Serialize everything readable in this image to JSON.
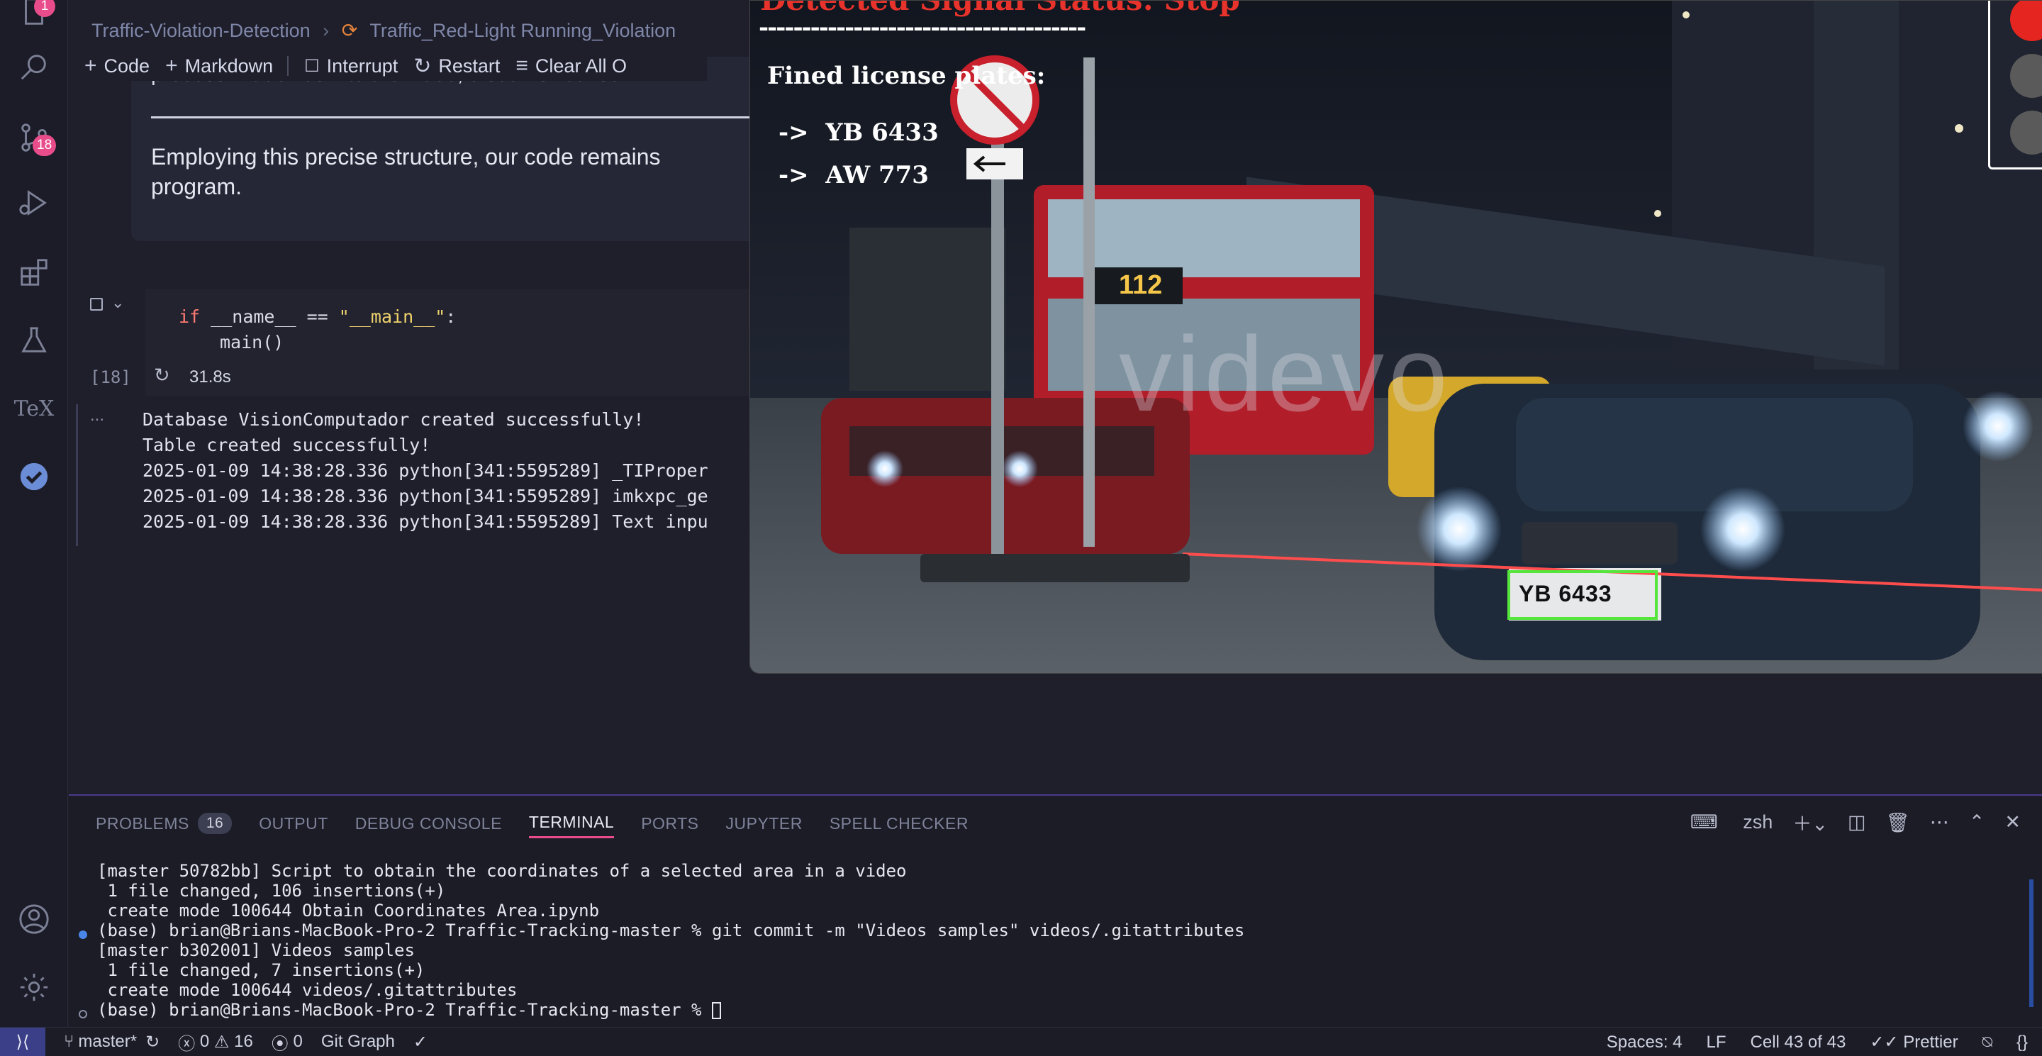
{
  "activity": {
    "explorer_badge": "1",
    "scm_badge": "18"
  },
  "breadcrumb": {
    "folder": "Traffic-Violation-Detection",
    "file": "Traffic_Red-Light Running_Violation"
  },
  "toolbar": {
    "code": "Code",
    "markdown": "Markdown",
    "interrupt": "Interrupt",
    "restart": "Restart",
    "clear_all": "Clear All O"
  },
  "markdown_cell": {
    "top_line": "process—it delves into the video, discerns license",
    "paragraph": "Employing this precise structure, our code remains\nprogram."
  },
  "code_cell": {
    "line1_kw": "if",
    "line1_mid": " __name__ == ",
    "line1_str": "\"__main__\"",
    "line1_end": ":",
    "line2": "main()",
    "exec_count": "[18]",
    "duration": "31.8s"
  },
  "output": {
    "dots": "...",
    "text": "Database VisionComputador created successfully!\nTable created successfully!\n2025-01-09 14:38:28.336 python[341:5595289] _TIProper\n2025-01-09 14:38:28.336 python[341:5595289] imkxpc_ge\n2025-01-09 14:38:28.336 python[341:5595289] Text inpu"
  },
  "video": {
    "signal_title": "Detected Signal Status: Stop",
    "dashes": "--------------------------------------",
    "fined_label": "Fined license plates:",
    "plates": [
      "->  YB 6433",
      "->  AW 773"
    ],
    "detected_plate": "YB 6433",
    "bus_number": "112",
    "watermark": "videvo",
    "light_colors": [
      "#e52520",
      "#5a5a5a",
      "#5a5a5a"
    ]
  },
  "panel": {
    "tabs": [
      {
        "label": "PROBLEMS",
        "count": "16"
      },
      {
        "label": "OUTPUT"
      },
      {
        "label": "DEBUG CONSOLE"
      },
      {
        "label": "TERMINAL"
      },
      {
        "label": "PORTS"
      },
      {
        "label": "JUPYTER"
      },
      {
        "label": "SPELL CHECKER"
      }
    ],
    "shell": "zsh",
    "terminal": "[master 50782bb] Script to obtain the coordinates of a selected area in a video\n 1 file changed, 106 insertions(+)\n create mode 100644 Obtain Coordinates Area.ipynb\n(base) brian@Brians-MacBook-Pro-2 Traffic-Tracking-master % git commit -m \"Videos samples\" videos/.gitattributes\n[master b302001] Videos samples\n 1 file changed, 7 insertions(+)\n create mode 100644 videos/.gitattributes\n(base) brian@Brians-MacBook-Pro-2 Traffic-Tracking-master % "
  },
  "status": {
    "branch": "master*",
    "errors": "0",
    "warnings": "16",
    "ports": "0",
    "git_graph": "Git Graph",
    "spaces": "Spaces: 4",
    "eol": "LF",
    "cell": "Cell 43 of 43",
    "prettier": "Prettier"
  },
  "colors": {
    "accent": "#e94c8b",
    "remote": "#3a3f87",
    "plate_box": "#55e53b",
    "stop_text": "#e7332b"
  }
}
